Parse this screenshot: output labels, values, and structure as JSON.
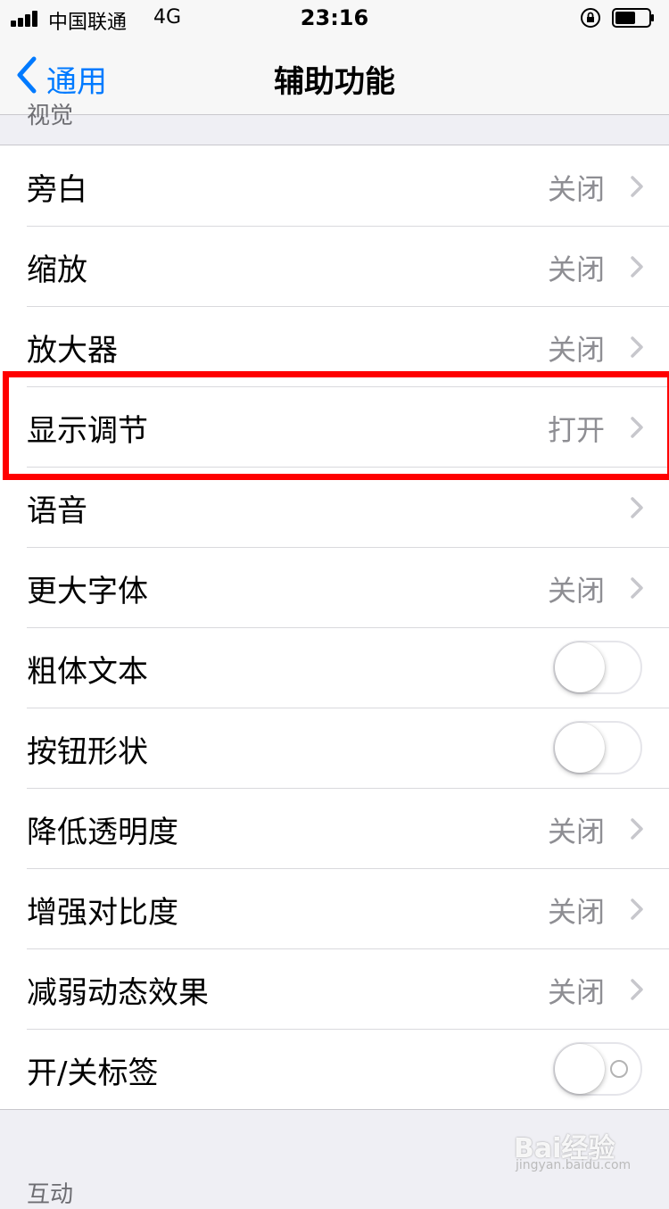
{
  "status_bar": {
    "carrier": "中国联通",
    "network": "4G",
    "time": "23:16"
  },
  "nav": {
    "back_label": "通用",
    "title": "辅助功能"
  },
  "section_header": "视觉",
  "rows": [
    {
      "label": "旁白",
      "value": "关闭",
      "type": "link"
    },
    {
      "label": "缩放",
      "value": "关闭",
      "type": "link"
    },
    {
      "label": "放大器",
      "value": "关闭",
      "type": "link"
    },
    {
      "label": "显示调节",
      "value": "打开",
      "type": "link"
    },
    {
      "label": "语音",
      "value": "",
      "type": "link"
    },
    {
      "label": "更大字体",
      "value": "关闭",
      "type": "link"
    },
    {
      "label": "粗体文本",
      "type": "toggle",
      "on": false
    },
    {
      "label": "按钮形状",
      "type": "toggle",
      "on": false
    },
    {
      "label": "降低透明度",
      "value": "关闭",
      "type": "link"
    },
    {
      "label": "增强对比度",
      "value": "关闭",
      "type": "link"
    },
    {
      "label": "减弱动态效果",
      "value": "关闭",
      "type": "link"
    },
    {
      "label": "开/关标签",
      "type": "toggle",
      "on": false
    }
  ],
  "section_footer": "互动",
  "watermark": {
    "main": "Bai经验",
    "sub": "jingyan.baidu.com"
  },
  "colors": {
    "accent": "#007aff",
    "highlight": "#ff0000",
    "background": "#efeff4"
  },
  "icons": [
    "signal-icon",
    "orientation-lock-icon",
    "battery-icon",
    "back-chevron-icon",
    "chevron-right-icon"
  ]
}
